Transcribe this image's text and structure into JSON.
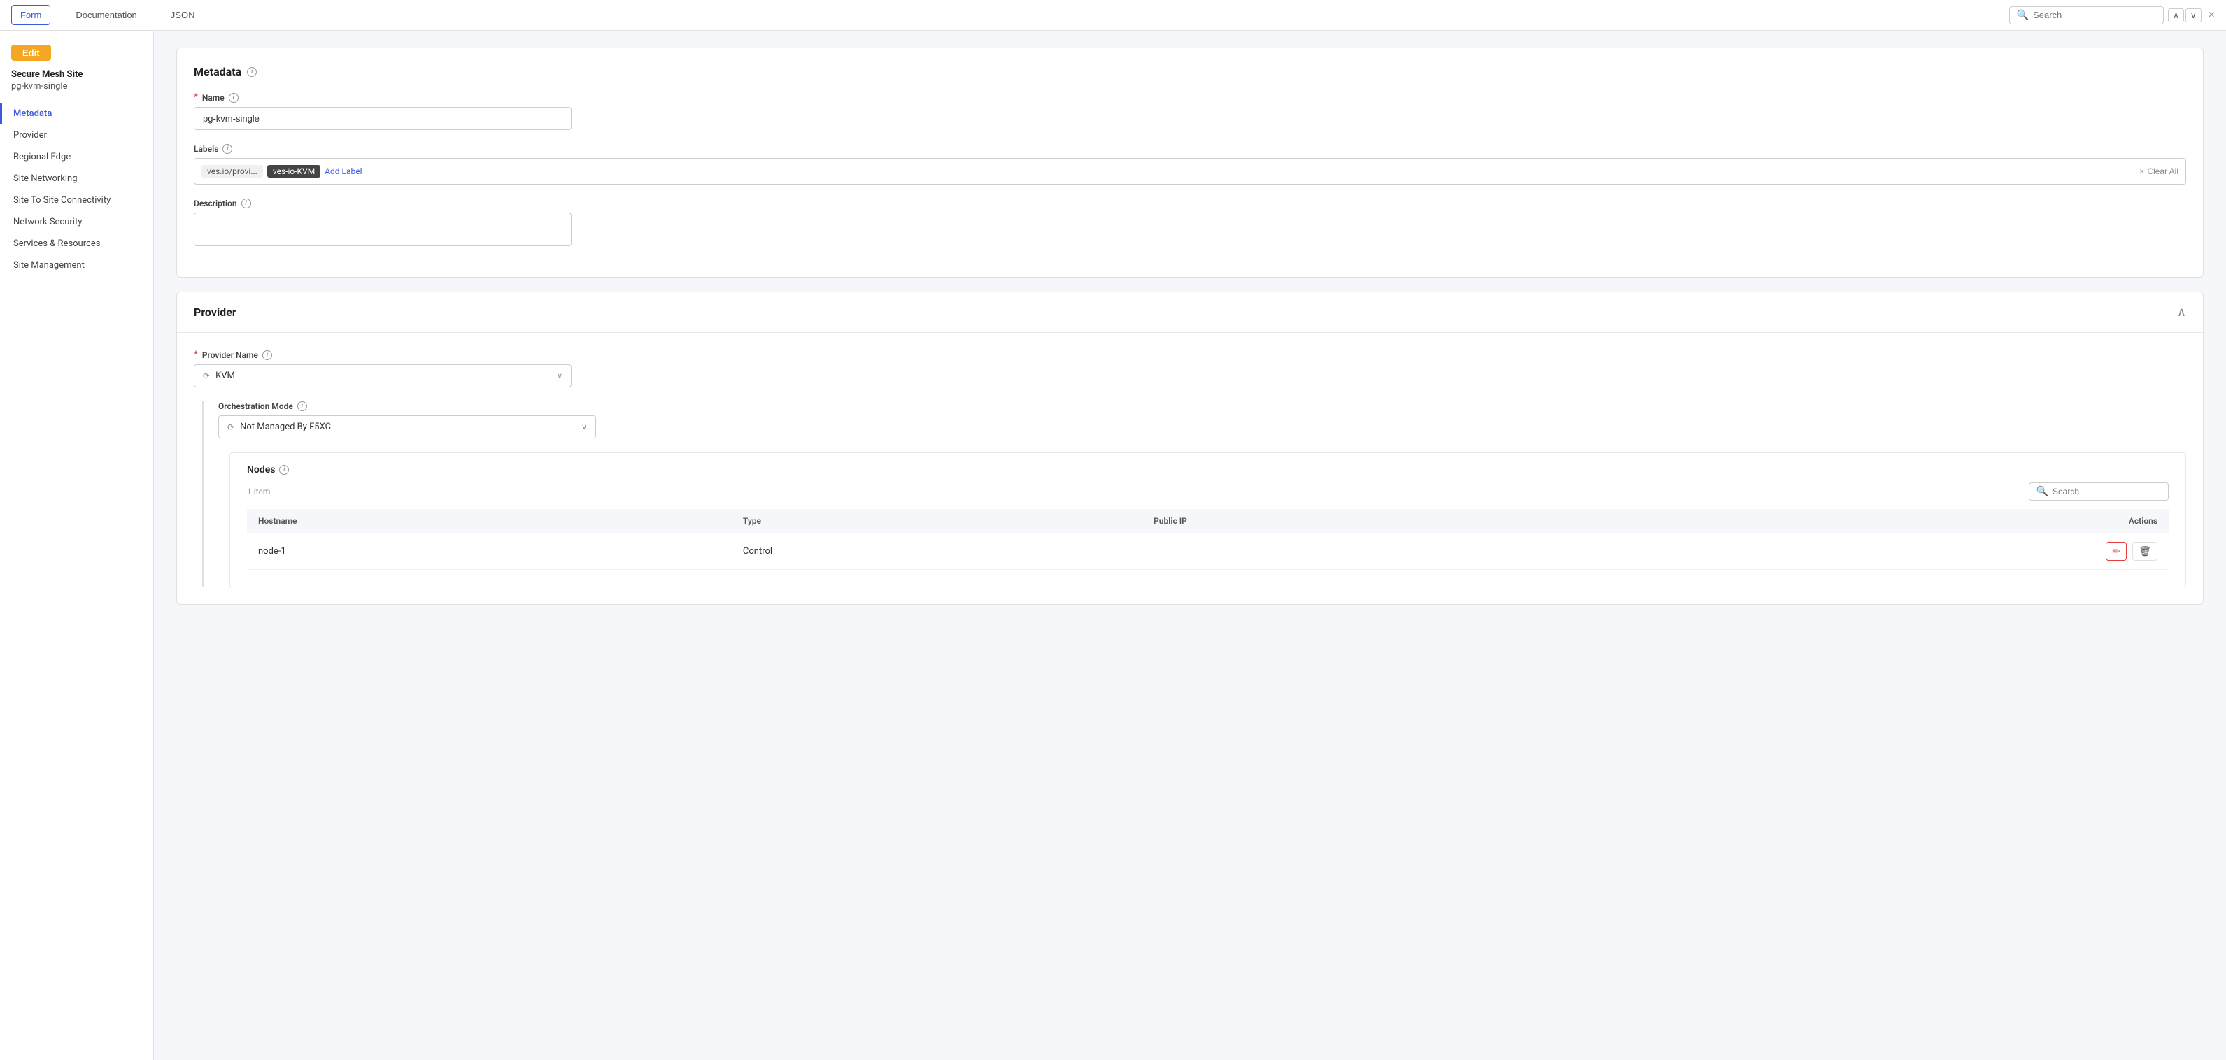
{
  "topbar": {
    "tabs": [
      {
        "id": "form",
        "label": "Form",
        "active": true
      },
      {
        "id": "documentation",
        "label": "Documentation",
        "active": false
      },
      {
        "id": "json",
        "label": "JSON",
        "active": false
      }
    ],
    "search": {
      "placeholder": "Search"
    }
  },
  "sidebar": {
    "edit_button": "Edit",
    "site_type": "Secure Mesh Site",
    "site_name": "pg-kvm-single",
    "nav_items": [
      {
        "id": "metadata",
        "label": "Metadata",
        "active": true
      },
      {
        "id": "provider",
        "label": "Provider",
        "active": false
      },
      {
        "id": "regional-edge",
        "label": "Regional Edge",
        "active": false
      },
      {
        "id": "site-networking",
        "label": "Site Networking",
        "active": false
      },
      {
        "id": "site-to-site",
        "label": "Site To Site Connectivity",
        "active": false
      },
      {
        "id": "network-security",
        "label": "Network Security",
        "active": false
      },
      {
        "id": "services-resources",
        "label": "Services & Resources",
        "active": false
      },
      {
        "id": "site-management",
        "label": "Site Management",
        "active": false
      }
    ]
  },
  "metadata": {
    "section_title": "Metadata",
    "name_label": "Name",
    "name_value": "pg-kvm-single",
    "labels_label": "Labels",
    "label_1": "ves.io/provi...",
    "label_2": "ves-io-KVM",
    "add_label": "Add Label",
    "clear_all": "Clear All",
    "description_label": "Description",
    "description_value": ""
  },
  "provider": {
    "section_title": "Provider",
    "provider_name_label": "Provider Name",
    "provider_value": "KVM",
    "orchestration_mode_label": "Orchestration Mode",
    "orchestration_value": "Not Managed By F5XC",
    "nodes": {
      "title": "Nodes",
      "count": "1 item",
      "search_placeholder": "Search",
      "columns": [
        "Hostname",
        "Type",
        "Public IP",
        "Actions"
      ],
      "rows": [
        {
          "hostname": "node-1",
          "type": "Control",
          "public_ip": ""
        }
      ]
    }
  },
  "icons": {
    "info": "i",
    "search": "🔍",
    "chevron_up": "∧",
    "chevron_down": "∨",
    "close": "×",
    "edit": "✏",
    "delete": "🗑",
    "collapse": "∧",
    "select_icon": "⟳"
  }
}
